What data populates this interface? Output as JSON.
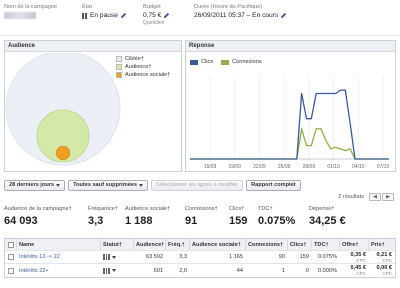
{
  "campaign": {
    "name_label": "Nom de la campagne",
    "state_label": "État",
    "state_value": "En pause",
    "budget_label": "Budget",
    "budget_value": "0,75 €",
    "budget_sub": "Quotidien",
    "duration_label": "Durée (Heure du Pacifique)",
    "duration_value": "26/09/2011 05:37 – En cours"
  },
  "audience_panel": {
    "title": "Audience",
    "legend": [
      {
        "label": "Ciblée†",
        "color": "#eceff5"
      },
      {
        "label": "Audience†",
        "color": "#d4e8a8"
      },
      {
        "label": "Audience sociale†",
        "color": "#f0a020"
      }
    ]
  },
  "reponse_panel": {
    "title": "Réponse",
    "legend": [
      {
        "label": "Clics",
        "color": "#3b5998"
      },
      {
        "label": "Connexions",
        "color": "#8fb04a"
      }
    ]
  },
  "chart_data": {
    "type": "line",
    "x": [
      "16/09",
      "19/09",
      "22/09",
      "25/09",
      "28/09",
      "01/10",
      "04/10",
      "07/10"
    ],
    "xlabel": "",
    "ylabel": "",
    "grid": true,
    "series": [
      {
        "name": "Clics",
        "color": "#3b5998",
        "values": [
          0,
          0,
          0,
          0,
          0,
          0,
          0,
          0,
          0,
          0,
          0,
          0,
          0,
          0,
          0,
          0,
          0,
          0,
          0,
          0,
          0,
          0,
          0,
          78,
          48,
          48,
          78,
          78,
          78,
          78,
          78,
          82,
          82,
          42,
          0,
          0,
          0,
          0,
          0,
          0,
          0,
          0
        ]
      },
      {
        "name": "Connexions",
        "color": "#8fb04a",
        "values": [
          0,
          0,
          0,
          0,
          0,
          0,
          0,
          0,
          0,
          0,
          0,
          0,
          0,
          0,
          0,
          0,
          0,
          0,
          0,
          0,
          0,
          0,
          0,
          36,
          16,
          16,
          36,
          36,
          22,
          12,
          14,
          12,
          10,
          12,
          0,
          0,
          0,
          0,
          0,
          0,
          0,
          0
        ]
      }
    ],
    "ylim": [
      0,
      100
    ]
  },
  "toolbar": {
    "period": "28 derniers jours",
    "filter": "Toutes sauf supprimées",
    "modify": "Sélectionner les lignes à modifier",
    "report": "Rapport complet",
    "results": "2 résultats"
  },
  "stats": [
    {
      "label": "Audience de la campagne†",
      "value": "64 093"
    },
    {
      "label": "Fréquence†",
      "value": "3,3"
    },
    {
      "label": "Audience sociale†",
      "value": "1 188"
    },
    {
      "label": "Connexions†",
      "value": "91"
    },
    {
      "label": "Clics†",
      "value": "159"
    },
    {
      "label": "TDC†",
      "value": "0.075%"
    },
    {
      "label": "Dépense†",
      "value": "34,25 €"
    }
  ],
  "table": {
    "headers": [
      "Name",
      "Statut†",
      "Audience†",
      "Fréq.†",
      "Audience sociale†",
      "Connexions†",
      "Clics†",
      "TDC†",
      "Offre†",
      "Prix†"
    ],
    "rows": [
      {
        "name": "Intérêts 13 -> 22",
        "audience": "63 592",
        "freq": "3,3",
        "social": "1 165",
        "connexions": "90",
        "clics": "159",
        "tdc": "0.075%",
        "offre": "0,35 €",
        "prix": "0,21 €",
        "unit": "CPC"
      },
      {
        "name": "Intérêts 22+",
        "audience": "501",
        "freq": "2,0",
        "social": "44",
        "connexions": "1",
        "clics": "0",
        "tdc": "0.000%",
        "offre": "0,45 €",
        "prix": "0,00 €",
        "unit": "CPC"
      }
    ]
  }
}
